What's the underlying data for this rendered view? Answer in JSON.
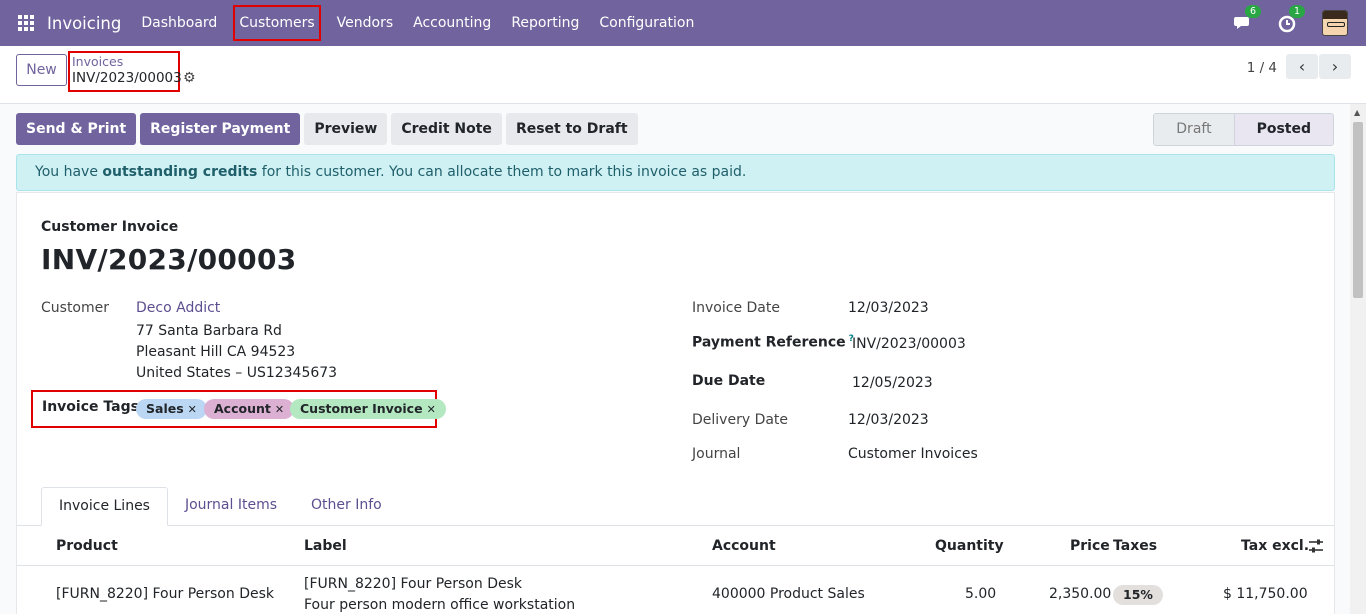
{
  "nav": {
    "app_title": "Invoicing",
    "items": [
      "Dashboard",
      "Customers",
      "Vendors",
      "Accounting",
      "Reporting",
      "Configuration"
    ],
    "messages_count": "6",
    "activities_count": "1",
    "accent_color": "#71639e"
  },
  "control": {
    "new_label": "New",
    "breadcrumb_parent": "Invoices",
    "breadcrumb_current": "INV/2023/00003",
    "pager": "1 / 4"
  },
  "actions": {
    "send_print": "Send & Print",
    "register_payment": "Register Payment",
    "preview": "Preview",
    "credit_note": "Credit Note",
    "reset_to_draft": "Reset to Draft"
  },
  "status": {
    "draft": "Draft",
    "posted": "Posted"
  },
  "alert": {
    "prefix": "You have ",
    "bold": "outstanding credits",
    "suffix": " for this customer. You can allocate them to mark this invoice as paid."
  },
  "invoice": {
    "type": "Customer Invoice",
    "number": "INV/2023/00003",
    "customer_label": "Customer",
    "customer_name": "Deco Addict",
    "address_line1": "77 Santa Barbara Rd",
    "address_line2": "Pleasant Hill CA 94523",
    "address_line3": "United States – US12345673",
    "tags_label": "Invoice Tags",
    "tags": [
      {
        "name": "Sales",
        "color": "#bcd7f3"
      },
      {
        "name": "Account",
        "color": "#dcb0d2"
      },
      {
        "name": "Customer Invoice",
        "color": "#b4e8c0"
      }
    ],
    "invoice_date_label": "Invoice Date",
    "invoice_date": "12/03/2023",
    "payment_ref_label": "Payment Reference",
    "payment_ref_help": "?",
    "payment_ref": "INV/2023/00003",
    "due_date_label": "Due Date",
    "due_date": "12/05/2023",
    "delivery_date_label": "Delivery Date",
    "delivery_date": "12/03/2023",
    "journal_label": "Journal",
    "journal": "Customer Invoices"
  },
  "tabs": [
    "Invoice Lines",
    "Journal Items",
    "Other Info"
  ],
  "lines": {
    "headers": {
      "product": "Product",
      "label": "Label",
      "account": "Account",
      "quantity": "Quantity",
      "price": "Price",
      "taxes": "Taxes",
      "tax_excl": "Tax excl."
    },
    "rows": [
      {
        "product": "[FURN_8220] Four Person Desk",
        "label_line1": "[FURN_8220] Four Person Desk",
        "label_line2": "Four person modern office workstation",
        "account": "400000 Product Sales",
        "quantity": "5.00",
        "price": "2,350.00",
        "taxes": "15%",
        "tax_excl": "$ 11,750.00"
      }
    ]
  }
}
